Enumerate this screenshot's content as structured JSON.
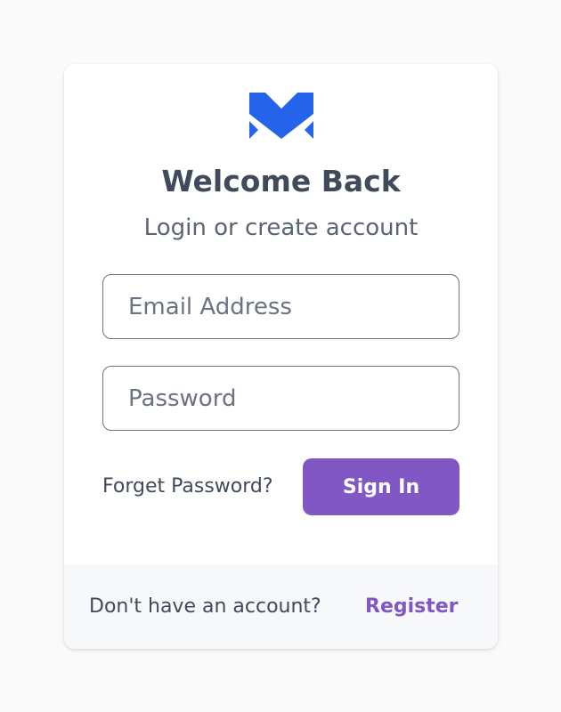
{
  "header": {
    "logo_icon": "m-logo-icon",
    "title": "Welcome Back",
    "subtitle": "Login or create account"
  },
  "form": {
    "email_placeholder": "Email Address",
    "email_value": "",
    "password_placeholder": "Password",
    "password_value": "",
    "forgot_label": "Forget Password?",
    "signin_label": "Sign In"
  },
  "footer": {
    "prompt": "Don't have an account?",
    "register_label": "Register"
  },
  "colors": {
    "brand_blue": "#2563eb",
    "accent_purple": "#8157c4",
    "text_dark": "#404a5a"
  }
}
